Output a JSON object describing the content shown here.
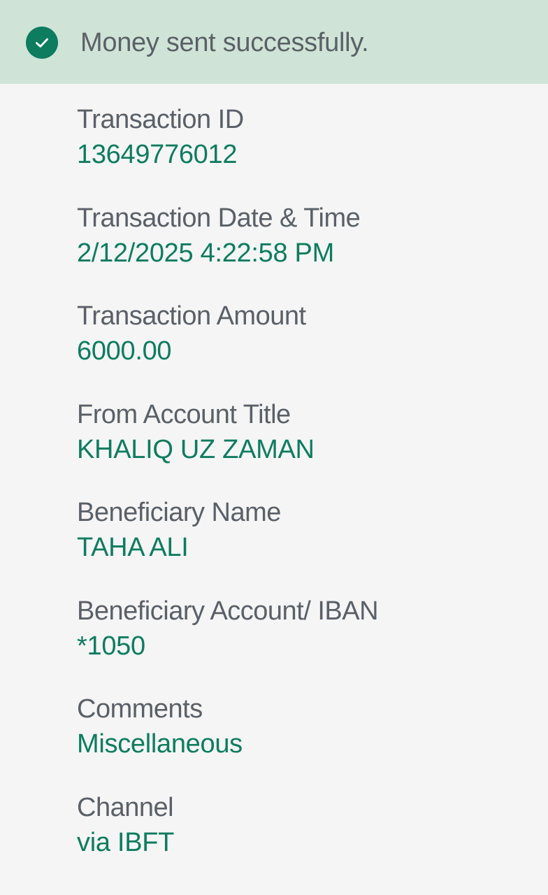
{
  "banner": {
    "icon": "check-circle-icon",
    "message": "Money sent successfully.",
    "background_color": "#cfe4d6",
    "icon_color": "#0d7c5f"
  },
  "colors": {
    "label": "#5a6068",
    "value": "#0d7c5f",
    "background": "#f5f5f5"
  },
  "fields": [
    {
      "label": "Transaction ID",
      "value": "13649776012"
    },
    {
      "label": "Transaction Date & Time",
      "value": "2/12/2025 4:22:58 PM"
    },
    {
      "label": "Transaction Amount",
      "value": "6000.00"
    },
    {
      "label": "From Account Title",
      "value": "KHALIQ UZ ZAMAN"
    },
    {
      "label": "Beneficiary Name",
      "value": "TAHA ALI"
    },
    {
      "label": "Beneficiary Account/ IBAN",
      "value": "*1050"
    },
    {
      "label": "Comments",
      "value": "Miscellaneous"
    },
    {
      "label": "Channel",
      "value": "via IBFT"
    }
  ]
}
